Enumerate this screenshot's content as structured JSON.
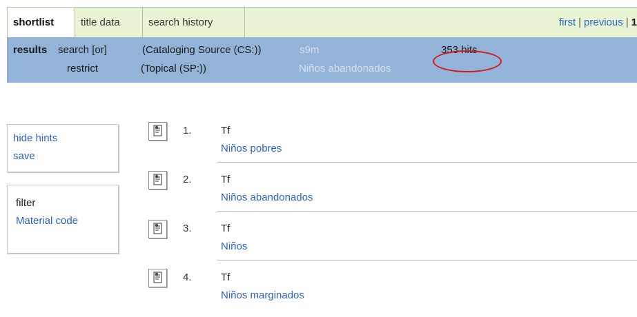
{
  "tabs": {
    "shortlist": "shortlist",
    "title_data": "title data",
    "search_history": "search history"
  },
  "pager": {
    "first": "first",
    "sep1": "|",
    "previous": "previous",
    "sep2": "|",
    "current": "1"
  },
  "results_bar": {
    "label": "results",
    "line1": {
      "op": "search [or]",
      "index": "(Cataloging Source (CS:))",
      "term": "s9m",
      "hits": "353 hits"
    },
    "line2": {
      "op": "restrict",
      "index": "(Topical (SP:))",
      "term": "Niños abandonados"
    }
  },
  "sidebar": {
    "hide_hints": "hide hints",
    "save": "save",
    "filter": "filter",
    "material_code": "Material code"
  },
  "records": [
    {
      "number": "1.",
      "type": "Tf",
      "title": "Niños pobres"
    },
    {
      "number": "2.",
      "type": "Tf",
      "title": "Niños abandonados"
    },
    {
      "number": "3.",
      "type": "Tf",
      "title": "Niños"
    },
    {
      "number": "4.",
      "type": "Tf",
      "title": "Niños marginados"
    }
  ],
  "colors": {
    "tab_bar": "#e8f4d4",
    "results_bar": "#93b3d8",
    "link": "#2a62c9",
    "highlight_oval": "#d21a1a"
  },
  "icons": {
    "record_thumbnail": "document-icon"
  }
}
